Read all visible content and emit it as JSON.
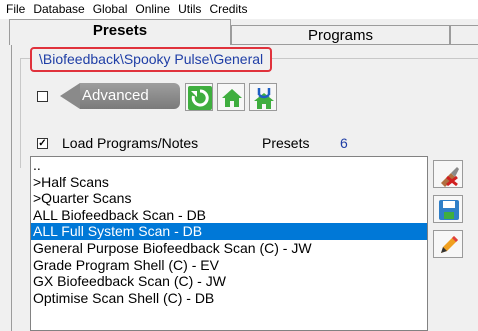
{
  "menu": [
    "File",
    "Database",
    "Global",
    "Online",
    "Utils",
    "Credits"
  ],
  "tabs": [
    {
      "label": "Presets",
      "active": true
    },
    {
      "label": "Programs",
      "active": false
    }
  ],
  "path": "\\Biofeedback\\Spooky Pulse\\General",
  "advanced": {
    "label": "Advanced",
    "checked": false
  },
  "toolbar_icons": [
    "refresh-icon",
    "home-icon",
    "home-up-icon"
  ],
  "load_programs": {
    "label": "Load Programs/Notes",
    "checked": true
  },
  "presets_count": {
    "label": "Presets",
    "value": "6"
  },
  "list": {
    "items": [
      "..",
      ">Half Scans",
      ">Quarter Scans",
      "ALL Biofeedback Scan - DB",
      "ALL Full System Scan - DB",
      "General Purpose Biofeedback Scan (C) - JW",
      "Grade Program Shell (C) - EV",
      "GX Biofeedback Scan (C) - JW",
      "Optimise Scan Shell (C) - DB"
    ],
    "selected_index": 4
  },
  "side_buttons": [
    "delete-brush-icon",
    "save-icon",
    "edit-pencil-icon"
  ],
  "colors": {
    "accent": "#0078d7",
    "path_text": "#1f3ea6",
    "highlight_border": "#e0323c",
    "toolbar_green": "#3fae3f"
  }
}
